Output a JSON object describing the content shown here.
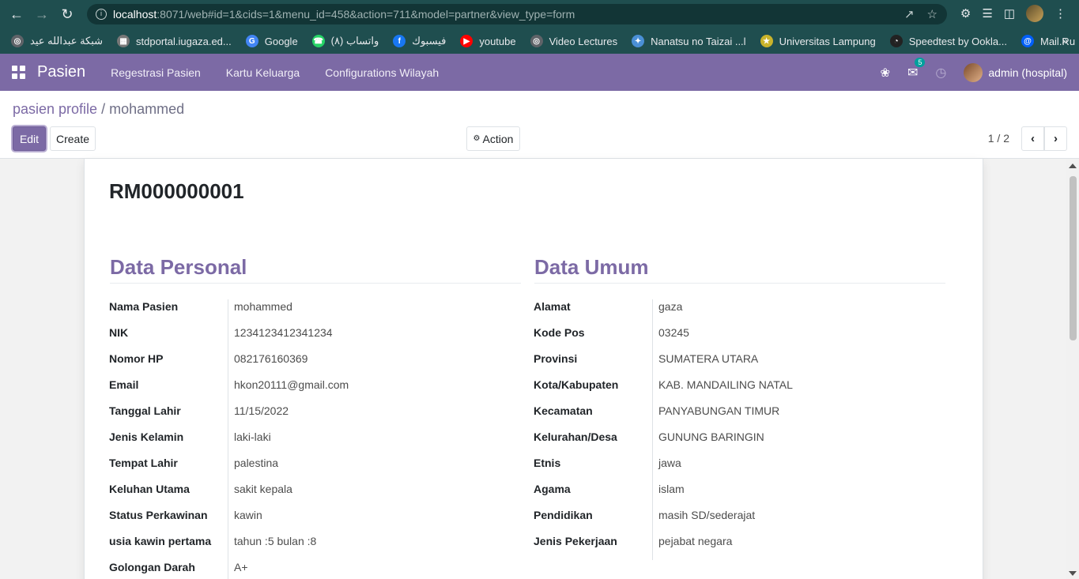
{
  "browser": {
    "url_host": "localhost",
    "url_rest": ":8071/web#id=1&cids=1&menu_id=458&action=711&model=partner&view_type=form",
    "bookmarks": [
      {
        "label": "شبكة عبدالله عيد",
        "icon": "globe-icon",
        "color": "#5f6368"
      },
      {
        "label": "stdportal.iugaza.ed...",
        "icon": "portal-icon",
        "color": "#777777"
      },
      {
        "label": "Google",
        "icon": "google-icon",
        "color": "#4285f4"
      },
      {
        "label": "واتساب (٨)",
        "icon": "whatsapp-icon",
        "color": "#25d366"
      },
      {
        "label": "فيسبوك",
        "icon": "facebook-icon",
        "color": "#1877f2"
      },
      {
        "label": "youtube",
        "icon": "youtube-icon",
        "color": "#ff0000"
      },
      {
        "label": "Video Lectures",
        "icon": "globe-icon",
        "color": "#5f6368"
      },
      {
        "label": "Nanatsu no Taizai ...l",
        "icon": "nanatsu-icon",
        "color": "#4a8fd6"
      },
      {
        "label": "Universitas Lampung",
        "icon": "unila-icon",
        "color": "#c9b32b"
      },
      {
        "label": "Speedtest by Ookla...",
        "icon": "speedtest-icon",
        "color": "#222222"
      },
      {
        "label": "Mail.Ru",
        "icon": "mailru-icon",
        "color": "#005ff9"
      }
    ]
  },
  "navbar": {
    "brand": "Pasien",
    "menu": [
      "Regestrasi Pasien",
      "Kartu Keluarga",
      "Configurations Wilayah"
    ],
    "message_count": "5",
    "user": "admin (hospital)"
  },
  "control_panel": {
    "breadcrumb_root": "pasien profile",
    "breadcrumb_sep": " / ",
    "breadcrumb_current": "mohammed",
    "edit_label": "Edit",
    "create_label": "Create",
    "action_label": "Action",
    "pager": "1 / 2"
  },
  "form": {
    "record_title": "RM000000001",
    "personal": {
      "title": "Data Personal",
      "fields": [
        {
          "label": "Nama Pasien",
          "value": "mohammed"
        },
        {
          "label": "NIK",
          "value": "1234123412341234"
        },
        {
          "label": "Nomor HP",
          "value": "082176160369"
        },
        {
          "label": "Email",
          "value": "hkon20111@gmail.com"
        },
        {
          "label": "Tanggal Lahir",
          "value": "11/15/2022"
        },
        {
          "label": "Jenis Kelamin",
          "value": "laki-laki"
        },
        {
          "label": "Tempat Lahir",
          "value": "palestina"
        },
        {
          "label": "Keluhan Utama",
          "value": "sakit kepala"
        },
        {
          "label": "Status Perkawinan",
          "value": "kawin"
        },
        {
          "label": "usia kawin pertama",
          "value": "tahun :5 bulan :8"
        },
        {
          "label": "Golongan Darah",
          "value": "A+"
        }
      ]
    },
    "umum": {
      "title": "Data Umum",
      "fields": [
        {
          "label": "Alamat",
          "value": "gaza"
        },
        {
          "label": "Kode Pos",
          "value": "03245"
        },
        {
          "label": "Provinsi",
          "value": "SUMATERA UTARA"
        },
        {
          "label": "Kota/Kabupaten",
          "value": "KAB. MANDAILING NATAL"
        },
        {
          "label": "Kecamatan",
          "value": "PANYABUNGAN TIMUR"
        },
        {
          "label": "Kelurahan/Desa",
          "value": "GUNUNG BARINGIN"
        },
        {
          "label": "Etnis",
          "value": "jawa"
        },
        {
          "label": "Agama",
          "value": "islam"
        },
        {
          "label": "Pendidikan",
          "value": "masih SD/sederajat"
        },
        {
          "label": "Jenis Pekerjaan",
          "value": "pejabat negara"
        }
      ]
    }
  }
}
